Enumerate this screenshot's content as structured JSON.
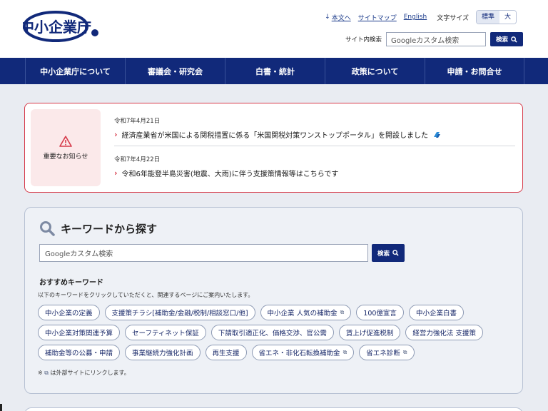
{
  "header": {
    "logo_text": "中小企業庁",
    "util_links": [
      "本文へ",
      "サイトマップ",
      "English"
    ],
    "fontsize_label": "文字サイズ",
    "fontsize_options": [
      "標準",
      "大"
    ],
    "search_label": "サイト内検索",
    "search_placeholder": "Googleカスタム検索",
    "search_button": "検索"
  },
  "nav": [
    "中小企業庁について",
    "審議会・研究会",
    "白書・統計",
    "政策について",
    "申請・お問合せ"
  ],
  "notice": {
    "title": "重要なお知らせ",
    "items": [
      {
        "date": "令和7年4月21日",
        "text": "経済産業省が米国による関税措置に係る「米国関税対策ワンストップポータル」を開設しました"
      },
      {
        "date": "令和7年4月22日",
        "text": "令和6年能登半島災害(地震、大雨)に伴う支援策情報等はこちらです"
      }
    ]
  },
  "keyword": {
    "title": "キーワードから探す",
    "placeholder": "Googleカスタム検索",
    "button": "検索",
    "rec_title": "おすすめキーワード",
    "rec_desc": "以下のキーワードをクリックしていただくと、関連するページにご案内いたします。",
    "chips": [
      {
        "label": "中小企業の定義",
        "external": false
      },
      {
        "label": "支援策チラシ[補助金/金融/税制/相談窓口/他]",
        "external": false
      },
      {
        "label": "中小企業 人気の補助金",
        "external": true
      },
      {
        "label": "100億宣言",
        "external": false
      },
      {
        "label": "中小企業白書",
        "external": false
      },
      {
        "label": "中小企業対策関連予算",
        "external": false
      },
      {
        "label": "セーフティネット保証",
        "external": false
      },
      {
        "label": "下請取引適正化、価格交渉、官公需",
        "external": false
      },
      {
        "label": "賃上げ促進税制",
        "external": false
      },
      {
        "label": "経営力強化法 支援策",
        "external": false
      },
      {
        "label": "補助金等の公募・申請",
        "external": false
      },
      {
        "label": "事業継続力強化計画",
        "external": false
      },
      {
        "label": "再生支援",
        "external": false
      },
      {
        "label": "省エネ・非化石転換補助金",
        "external": true
      },
      {
        "label": "省エネ診断",
        "external": true
      }
    ],
    "ext_note": "は外部サイトにリンクします。",
    "ext_note_prefix": "※"
  },
  "colors": {
    "navy": "#11297a",
    "alert_red": "#d63a4a",
    "panel_bg": "#eef1f6"
  }
}
